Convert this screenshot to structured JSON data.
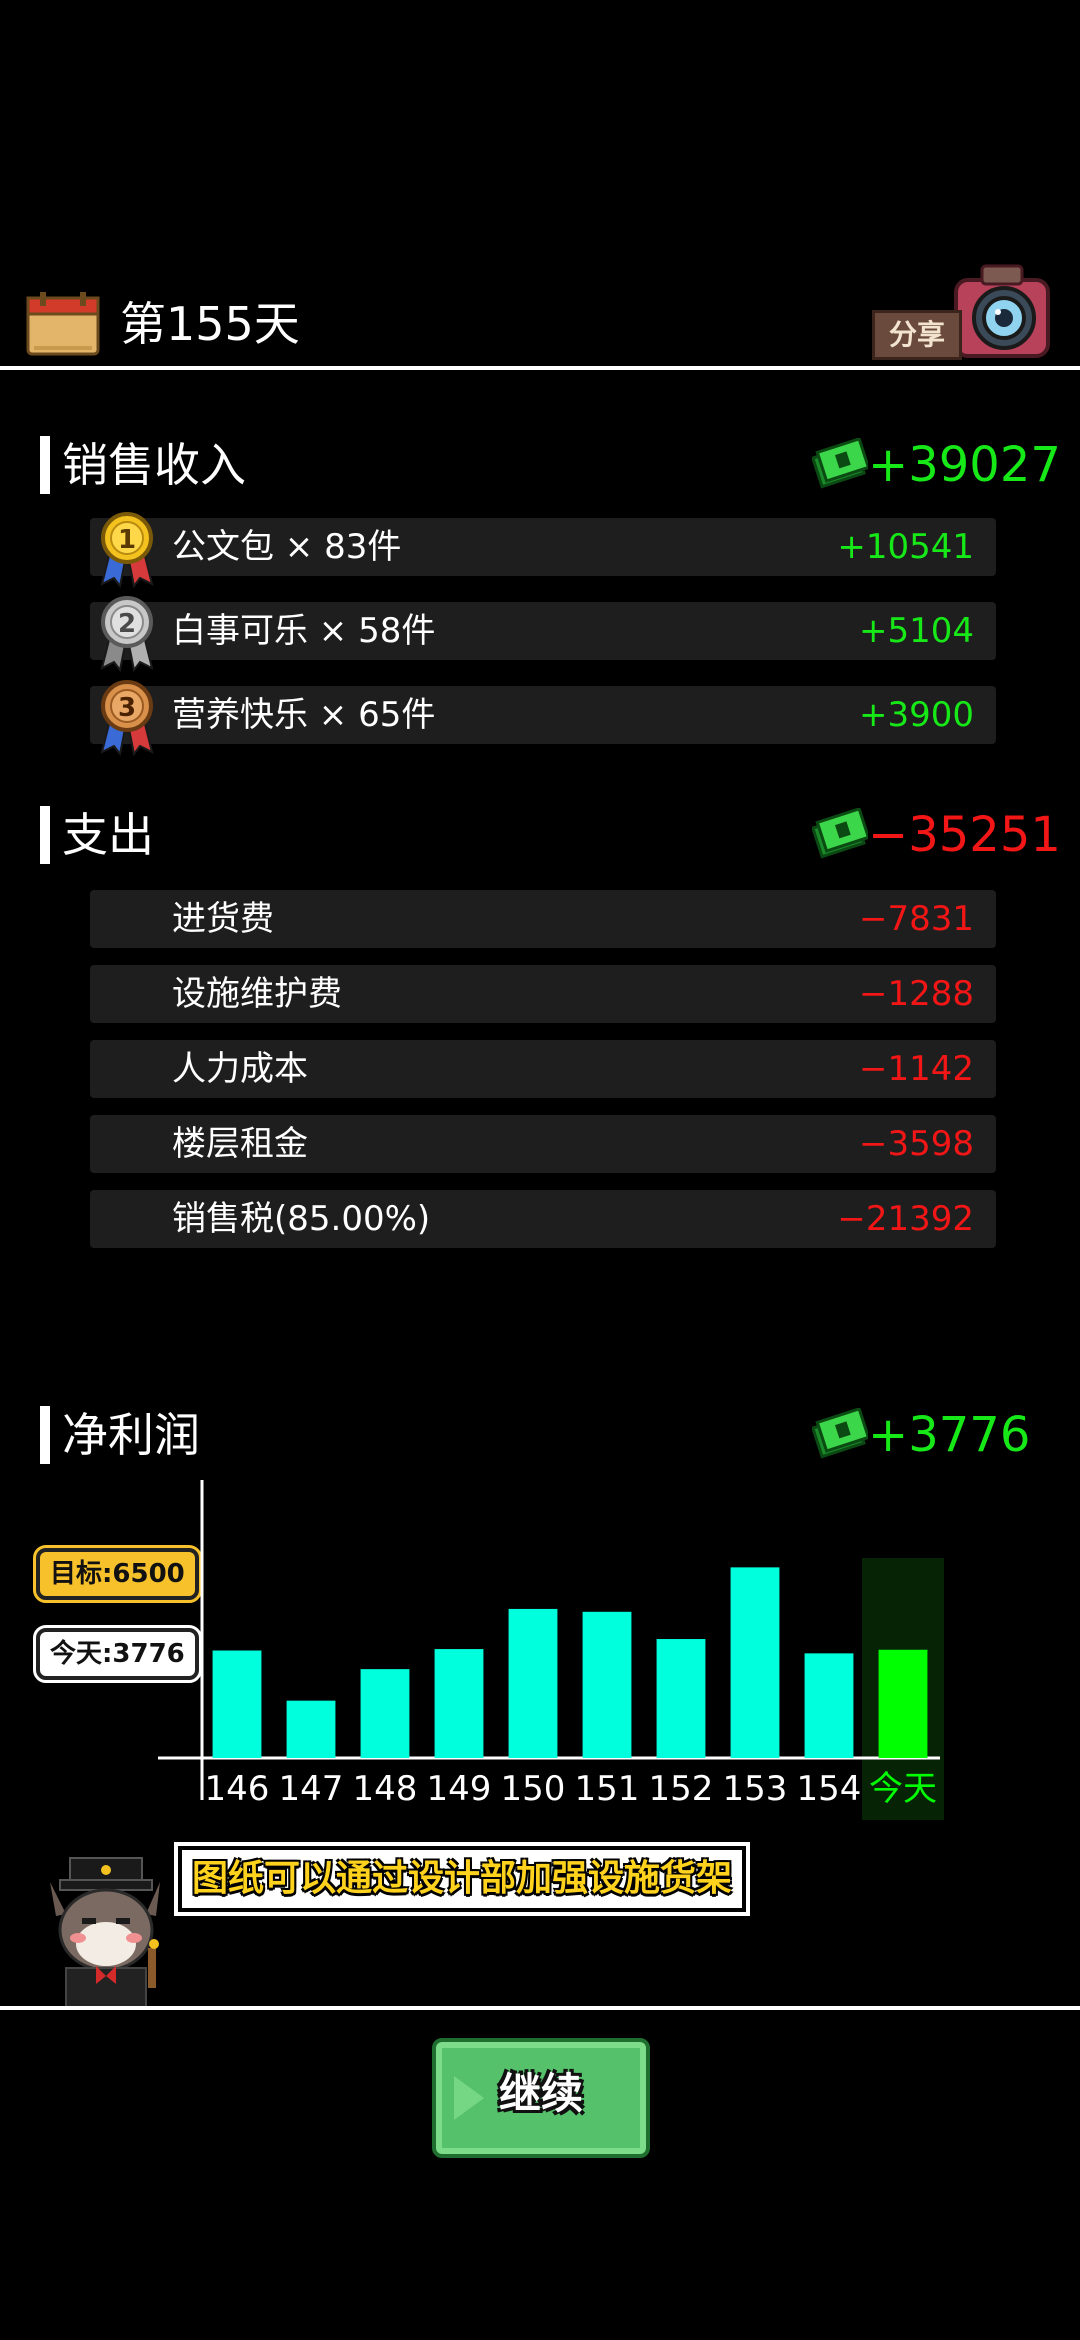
{
  "header": {
    "day_label": "第155天",
    "share_label": "分享"
  },
  "sales": {
    "title": "销售收入",
    "total": "+39027",
    "items": [
      {
        "rank": "1",
        "label": "公文包 × 83件",
        "value": "+10541"
      },
      {
        "rank": "2",
        "label": "白事可乐 × 58件",
        "value": "+5104"
      },
      {
        "rank": "3",
        "label": "营养快乐 × 65件",
        "value": "+3900"
      }
    ]
  },
  "expenses": {
    "title": "支出",
    "total": "−35251",
    "items": [
      {
        "label": "进货费",
        "value": "−7831"
      },
      {
        "label": "设施维护费",
        "value": "−1288"
      },
      {
        "label": "人力成本",
        "value": "−1142"
      },
      {
        "label": "楼层租金",
        "value": "−3598"
      },
      {
        "label": "销售税(85.00%)",
        "value": "−21392"
      }
    ]
  },
  "profit": {
    "title": "净利润",
    "total": "+3776"
  },
  "chart_badges": {
    "target": "目标:6500",
    "today": "今天:3776"
  },
  "chart_data": {
    "type": "bar",
    "categories": [
      "146",
      "147",
      "148",
      "149",
      "150",
      "151",
      "152",
      "153",
      "154",
      "今天"
    ],
    "values": [
      3750,
      2000,
      3100,
      3800,
      5200,
      5100,
      4150,
      6650,
      3650,
      3776
    ],
    "ylim": [
      0,
      9000
    ],
    "highlight_index": 9,
    "colors": {
      "bar": "#00ffdd",
      "today": "#00ff00",
      "highlight_bg": "#062306"
    }
  },
  "tip": {
    "text": "图纸可以通过设计部加强设施货架"
  },
  "continue_button": {
    "label": "继续"
  },
  "colors": {
    "positive": "#17e817",
    "negative": "#f21616",
    "row_bg": "#1e1e1e"
  }
}
